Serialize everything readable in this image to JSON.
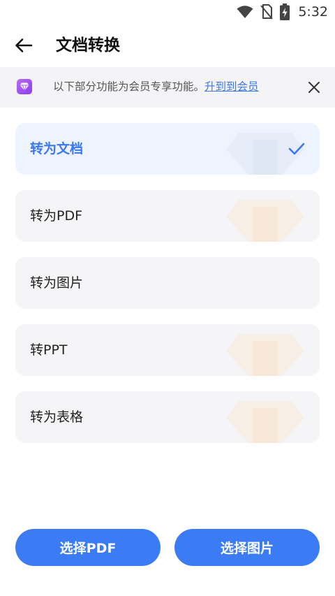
{
  "status_bar": {
    "time": "5:32",
    "icons": [
      "wifi-icon",
      "no-sim-icon",
      "battery-charging-icon"
    ]
  },
  "header": {
    "title": "文档转换",
    "back_icon": "back-arrow-icon"
  },
  "banner": {
    "icon": "diamond-icon",
    "text": "以下部分功能为会员专享功能。",
    "link": "升到到会员",
    "close_icon": "close-icon",
    "accent_color": "#9b4cf2"
  },
  "options": [
    {
      "label": "转为文档",
      "selected": true
    },
    {
      "label": "转为PDF",
      "selected": false
    },
    {
      "label": "转为图片",
      "selected": false
    },
    {
      "label": "转PPT",
      "selected": false
    },
    {
      "label": "转为表格",
      "selected": false
    }
  ],
  "buttons": {
    "select_pdf": "选择PDF",
    "select_image": "选择图片"
  },
  "colors": {
    "primary": "#3b7cf4",
    "selected_bg": "#edf3ff",
    "card_bg": "#f5f5f7",
    "banner_bg": "#f4f4f6"
  }
}
